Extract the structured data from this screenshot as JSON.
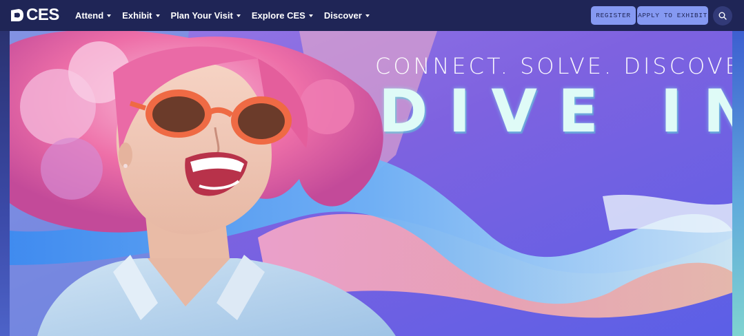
{
  "brand": {
    "name": "CES"
  },
  "nav": {
    "items": [
      {
        "label": "Attend"
      },
      {
        "label": "Exhibit"
      },
      {
        "label": "Plan Your Visit"
      },
      {
        "label": "Explore CES"
      },
      {
        "label": "Discover"
      }
    ],
    "register_label": "REGISTER",
    "apply_label": "APPLY TO EXHIBIT",
    "search_icon": "search-icon"
  },
  "hero": {
    "tagline": "CONNECT. SOLVE. DISCOVER.",
    "headline": "DIVE IN"
  },
  "colors": {
    "nav_background": "#1f2556",
    "button_background": "#8599f2",
    "button_text": "#1f2556",
    "hero_purple": "#7a5ee0"
  }
}
